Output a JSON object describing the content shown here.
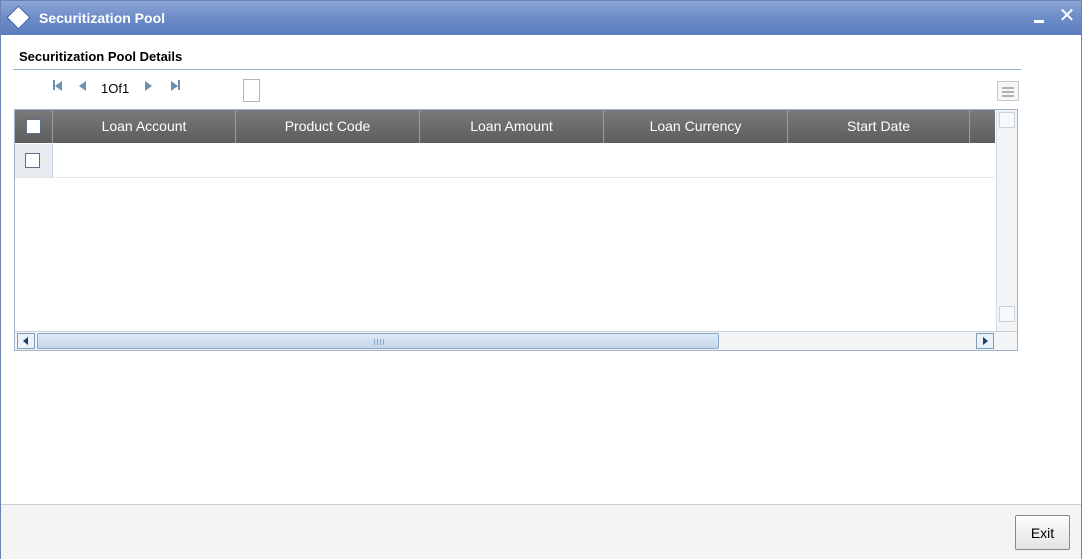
{
  "window": {
    "title": "Securitization Pool",
    "minimize_label": "",
    "close_label": "✕"
  },
  "section": {
    "title": "Securitization Pool Details"
  },
  "pager": {
    "text": "1Of1",
    "page_value": ""
  },
  "grid": {
    "columns": [
      "Loan Account",
      "Product Code",
      "Loan Amount",
      "Loan Currency",
      "Start Date"
    ],
    "rows": [
      {
        "selected": false,
        "cells": [
          "",
          "",
          "",
          "",
          ""
        ]
      }
    ]
  },
  "footer": {
    "exit_label": "Exit"
  },
  "colors": {
    "titlebar": "#6f8ec9",
    "grid_header": "#6a6a6a",
    "accent": "#8fb0c8"
  }
}
